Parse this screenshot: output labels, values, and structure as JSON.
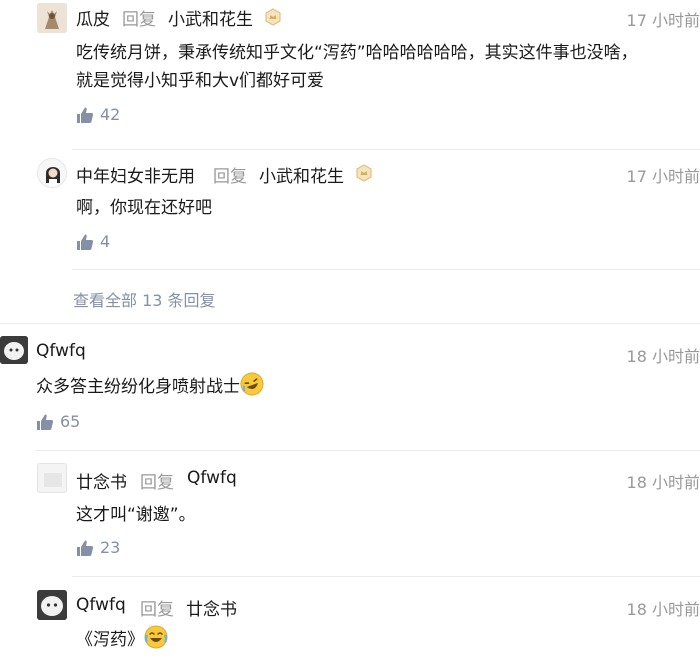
{
  "comments": [
    {
      "author": "瓜皮",
      "reply_label": "回复",
      "reply_to": "小武和花生",
      "time": "17 小时前",
      "lines": [
        "吃传统月饼，秉承传统知乎文化“泻药”哈哈哈哈哈哈，其实这件事也没啥，",
        "就是觉得小知乎和大v们都好可爱"
      ],
      "likes": "42"
    },
    {
      "author": "中年妇女非无用",
      "reply_label": "回复",
      "reply_to": "小武和花生",
      "time": "17 小时前",
      "lines": [
        "啊，你现在还好吧"
      ],
      "likes": "4"
    },
    {
      "author": "Qfwfq",
      "time": "18 小时前",
      "lines": [
        "众多答主纷纷化身喷射战士"
      ],
      "likes": "65"
    },
    {
      "author": "廿念书",
      "reply_label": "回复",
      "reply_to": "Qfwfq",
      "time": "18 小时前",
      "lines": [
        "这才叫“谢邀”。"
      ],
      "likes": "23"
    },
    {
      "author": "Qfwfq",
      "reply_label": "回复",
      "reply_to": "廿念书",
      "time": "18 小时前",
      "lines": [
        "《泻药》"
      ]
    }
  ],
  "view_all": "查看全部 13 条回复",
  "icons": {
    "like": "thumbs-up-icon",
    "badge": "verified-badge-icon",
    "emoji_laugh": "rofl-emoji-icon",
    "emoji_cry_laugh": "tears-of-joy-emoji-icon"
  },
  "colors": {
    "meta": "#999999",
    "like": "#8590a6",
    "badge": "#e3c27d"
  }
}
